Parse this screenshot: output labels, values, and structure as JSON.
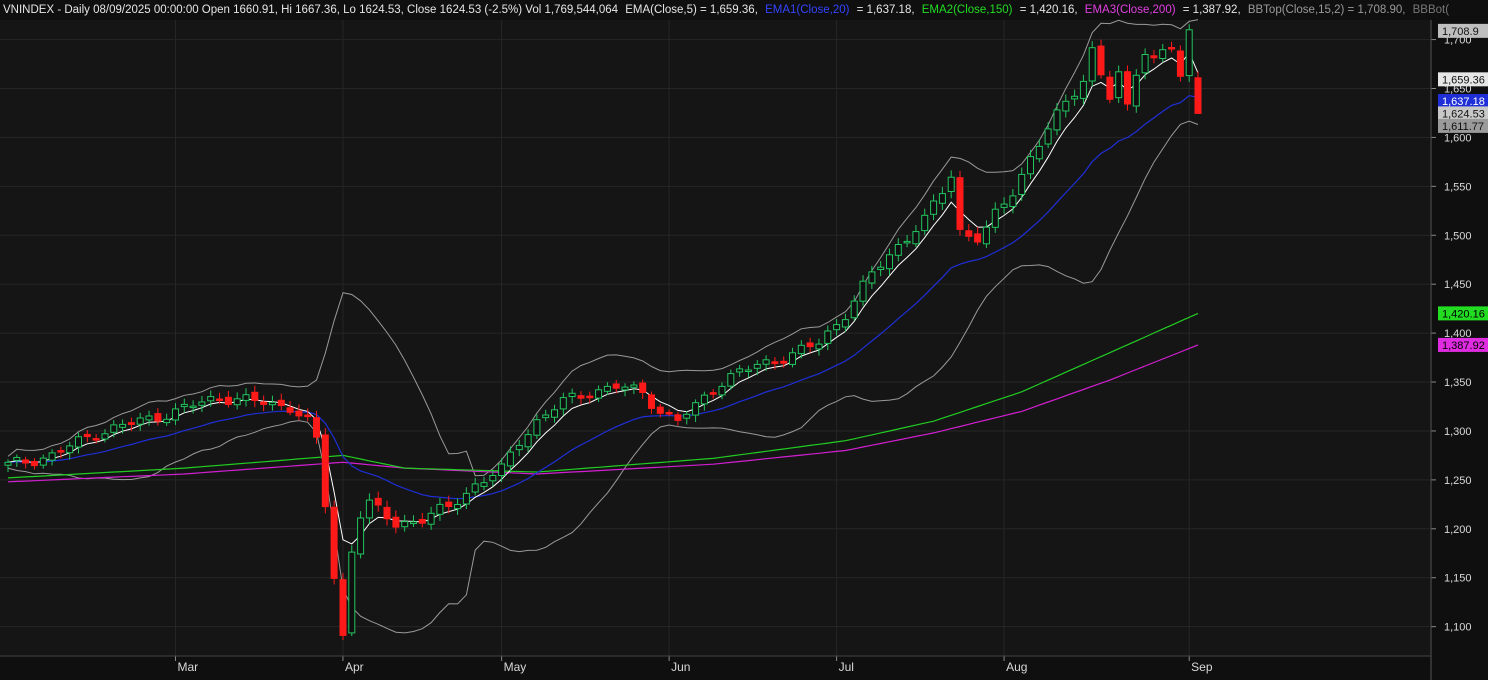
{
  "header": {
    "symbol_line": "VNINDEX - Daily 08/09/2025 00:00:00 Open 1660.91, Hi 1667.36, Lo 1624.53, Close 1624.53 (-2.5%) Vol 1,769,544,064",
    "ema5_label": "EMA(Close,5) = 1,659.36,",
    "ema1_label": "EMA1(Close,20)",
    "ema1_value": "= 1,637.18,",
    "ema2_label": "EMA2(Close,150)",
    "ema2_value": "= 1,420.16,",
    "ema3_label": "EMA3(Close,200)",
    "ema3_value": "= 1,387.92,",
    "bbtop_label": "BBTop(Close,15,2) = 1,708.90,",
    "bbbot_label": "BBBot("
  },
  "colors": {
    "background": "#0f0f0f",
    "plot_background": "#151515",
    "up_candle": "#22c55e",
    "down_candle": "#ff1a1a",
    "ema5": "#ffffff",
    "ema20": "#1f2fd8",
    "ema150": "#22cc22",
    "ema200": "#d21fd2",
    "bollinger": "#9a9a9a"
  },
  "chart_data": {
    "type": "candlestick",
    "title": "VNINDEX - Daily",
    "ylim": [
      1070,
      1720
    ],
    "yticks": [
      "1,100",
      "1,150",
      "1,200",
      "1,250",
      "1,300",
      "1,350",
      "1,400",
      "1,450",
      "1,500",
      "1,550",
      "1,600",
      "1,650",
      "1,700"
    ],
    "ytick_values": [
      1100,
      1150,
      1200,
      1250,
      1300,
      1350,
      1400,
      1450,
      1500,
      1550,
      1600,
      1650,
      1700
    ],
    "xticks": [
      "Mar",
      "Apr",
      "May",
      "Jun",
      "Jul",
      "Aug",
      "Sep"
    ],
    "xtick_index": [
      19,
      38,
      56,
      75,
      94,
      113,
      134
    ],
    "bars": 136,
    "grid": true,
    "legend": "top header line",
    "last_bar": {
      "date": "08/09/2025",
      "open": 1660.91,
      "high": 1667.36,
      "low": 1624.53,
      "close": 1624.53,
      "change_pct": -2.5,
      "volume": 1769544064
    },
    "close_anchors": [
      [
        0,
        1265
      ],
      [
        5,
        1275
      ],
      [
        10,
        1298
      ],
      [
        15,
        1310
      ],
      [
        19,
        1320
      ],
      [
        24,
        1335
      ],
      [
        28,
        1330
      ],
      [
        32,
        1325
      ],
      [
        34,
        1310
      ],
      [
        35,
        1290
      ],
      [
        36,
        1225
      ],
      [
        37,
        1150
      ],
      [
        38,
        1090
      ],
      [
        39,
        1180
      ],
      [
        40,
        1215
      ],
      [
        41,
        1225
      ],
      [
        44,
        1205
      ],
      [
        47,
        1210
      ],
      [
        50,
        1222
      ],
      [
        53,
        1245
      ],
      [
        56,
        1260
      ],
      [
        58,
        1290
      ],
      [
        60,
        1310
      ],
      [
        63,
        1330
      ],
      [
        66,
        1340
      ],
      [
        69,
        1345
      ],
      [
        72,
        1340
      ],
      [
        74,
        1320
      ],
      [
        76,
        1310
      ],
      [
        78,
        1325
      ],
      [
        80,
        1345
      ],
      [
        83,
        1360
      ],
      [
        86,
        1370
      ],
      [
        89,
        1378
      ],
      [
        92,
        1390
      ],
      [
        95,
        1420
      ],
      [
        98,
        1460
      ],
      [
        101,
        1490
      ],
      [
        104,
        1515
      ],
      [
        106,
        1545
      ],
      [
        107,
        1562
      ],
      [
        108,
        1505
      ],
      [
        110,
        1497
      ],
      [
        111,
        1505
      ],
      [
        112,
        1520
      ],
      [
        114,
        1545
      ],
      [
        116,
        1580
      ],
      [
        118,
        1608
      ],
      [
        120,
        1635
      ],
      [
        122,
        1660
      ],
      [
        123,
        1690
      ],
      [
        124,
        1665
      ],
      [
        125,
        1640
      ],
      [
        126,
        1662
      ],
      [
        127,
        1630
      ],
      [
        128,
        1668
      ],
      [
        129,
        1690
      ],
      [
        130,
        1680
      ],
      [
        131,
        1688
      ],
      [
        132,
        1692
      ],
      [
        133,
        1660
      ],
      [
        134,
        1705
      ],
      [
        135,
        1660.91
      ]
    ],
    "series": [
      {
        "name": "EMA(Close,5)",
        "last": 1659.36
      },
      {
        "name": "EMA1(Close,20)",
        "last": 1637.18
      },
      {
        "name": "EMA2(Close,150)",
        "last": 1420.16
      },
      {
        "name": "EMA3(Close,200)",
        "last": 1387.92
      },
      {
        "name": "BBTop(Close,15,2)",
        "last": 1708.9
      },
      {
        "name": "BBBot",
        "last": 1611.77
      }
    ],
    "ema150_anchors": [
      [
        0,
        1252
      ],
      [
        20,
        1262
      ],
      [
        38,
        1275
      ],
      [
        45,
        1262
      ],
      [
        60,
        1258
      ],
      [
        80,
        1272
      ],
      [
        95,
        1290
      ],
      [
        105,
        1310
      ],
      [
        115,
        1340
      ],
      [
        125,
        1380
      ],
      [
        135,
        1420.16
      ]
    ],
    "ema200_anchors": [
      [
        0,
        1248
      ],
      [
        20,
        1256
      ],
      [
        38,
        1268
      ],
      [
        45,
        1262
      ],
      [
        60,
        1256
      ],
      [
        80,
        1266
      ],
      [
        95,
        1280
      ],
      [
        105,
        1298
      ],
      [
        115,
        1320
      ],
      [
        125,
        1352
      ],
      [
        135,
        1387.92
      ]
    ],
    "price_tags": [
      {
        "label": "1,708.9",
        "value": 1708.9,
        "bg": "#bfbfbf",
        "fg": "#111111"
      },
      {
        "label": "1,659.36",
        "value": 1659.36,
        "bg": "#e6e6e6",
        "fg": "#111111"
      },
      {
        "label": "1,637.18",
        "value": 1637.18,
        "bg": "#1f2fd8",
        "fg": "#ffffff"
      },
      {
        "label": "1,624.53",
        "value": 1624.53,
        "bg": "#c8c8c8",
        "fg": "#111111"
      },
      {
        "label": "1,611.77",
        "value": 1611.77,
        "bg": "#9a9a9a",
        "fg": "#111111"
      },
      {
        "label": "1,420.16",
        "value": 1420.16,
        "bg": "#22dd22",
        "fg": "#000000"
      },
      {
        "label": "1,387.92",
        "value": 1387.92,
        "bg": "#e02ce0",
        "fg": "#000000"
      }
    ]
  }
}
